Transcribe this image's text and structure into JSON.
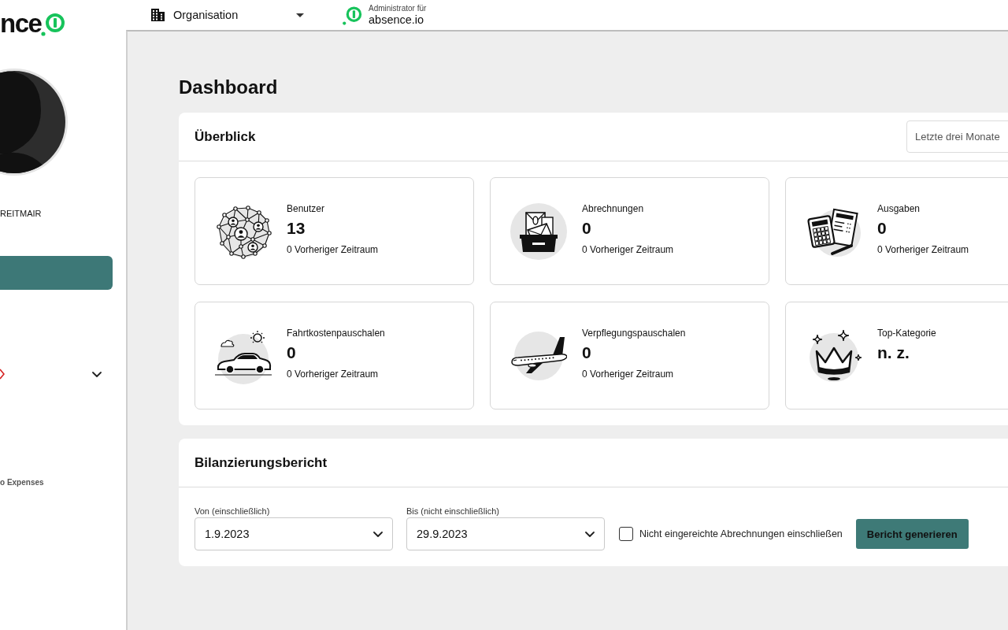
{
  "sidebar": {
    "logo_text": "nce",
    "user_name": "REITMAIR",
    "nav_item": "o Expenses"
  },
  "topbar": {
    "organisation": "Organisation",
    "admin_label": "Administrator für",
    "admin_company": "absence.io"
  },
  "page_title": "Dashboard",
  "overview": {
    "title": "Überblick",
    "period": "Letzte drei Monate",
    "stats": [
      {
        "kind": "users",
        "label": "Benutzer",
        "value": "13",
        "previous": "0 Vorheriger Zeitraum"
      },
      {
        "kind": "settlements",
        "label": "Abrechnungen",
        "value": "0",
        "previous": "0 Vorheriger Zeitraum"
      },
      {
        "kind": "expenses",
        "label": "Ausgaben",
        "value": "0",
        "previous": "0 Vorheriger Zeitraum"
      },
      {
        "kind": "mileage",
        "label": "Fahrtkostenpauschalen",
        "value": "0",
        "previous": "0 Vorheriger Zeitraum"
      },
      {
        "kind": "meals",
        "label": "Verpflegungspauschalen",
        "value": "0",
        "previous": "0 Vorheriger Zeitraum"
      },
      {
        "kind": "category",
        "label": "Top-Kategorie",
        "value": "n. z."
      }
    ]
  },
  "report": {
    "title": "Bilanzierungsbericht",
    "from": {
      "label": "Von (einschließlich)",
      "value": "1.9.2023"
    },
    "to": {
      "label": "Bis (nicht einschließlich)",
      "value": "29.9.2023"
    },
    "include_unsubmitted": {
      "label": "Nicht eingereichte Abrechnungen einschließen",
      "checked": false
    },
    "button": "Bericht generieren"
  }
}
